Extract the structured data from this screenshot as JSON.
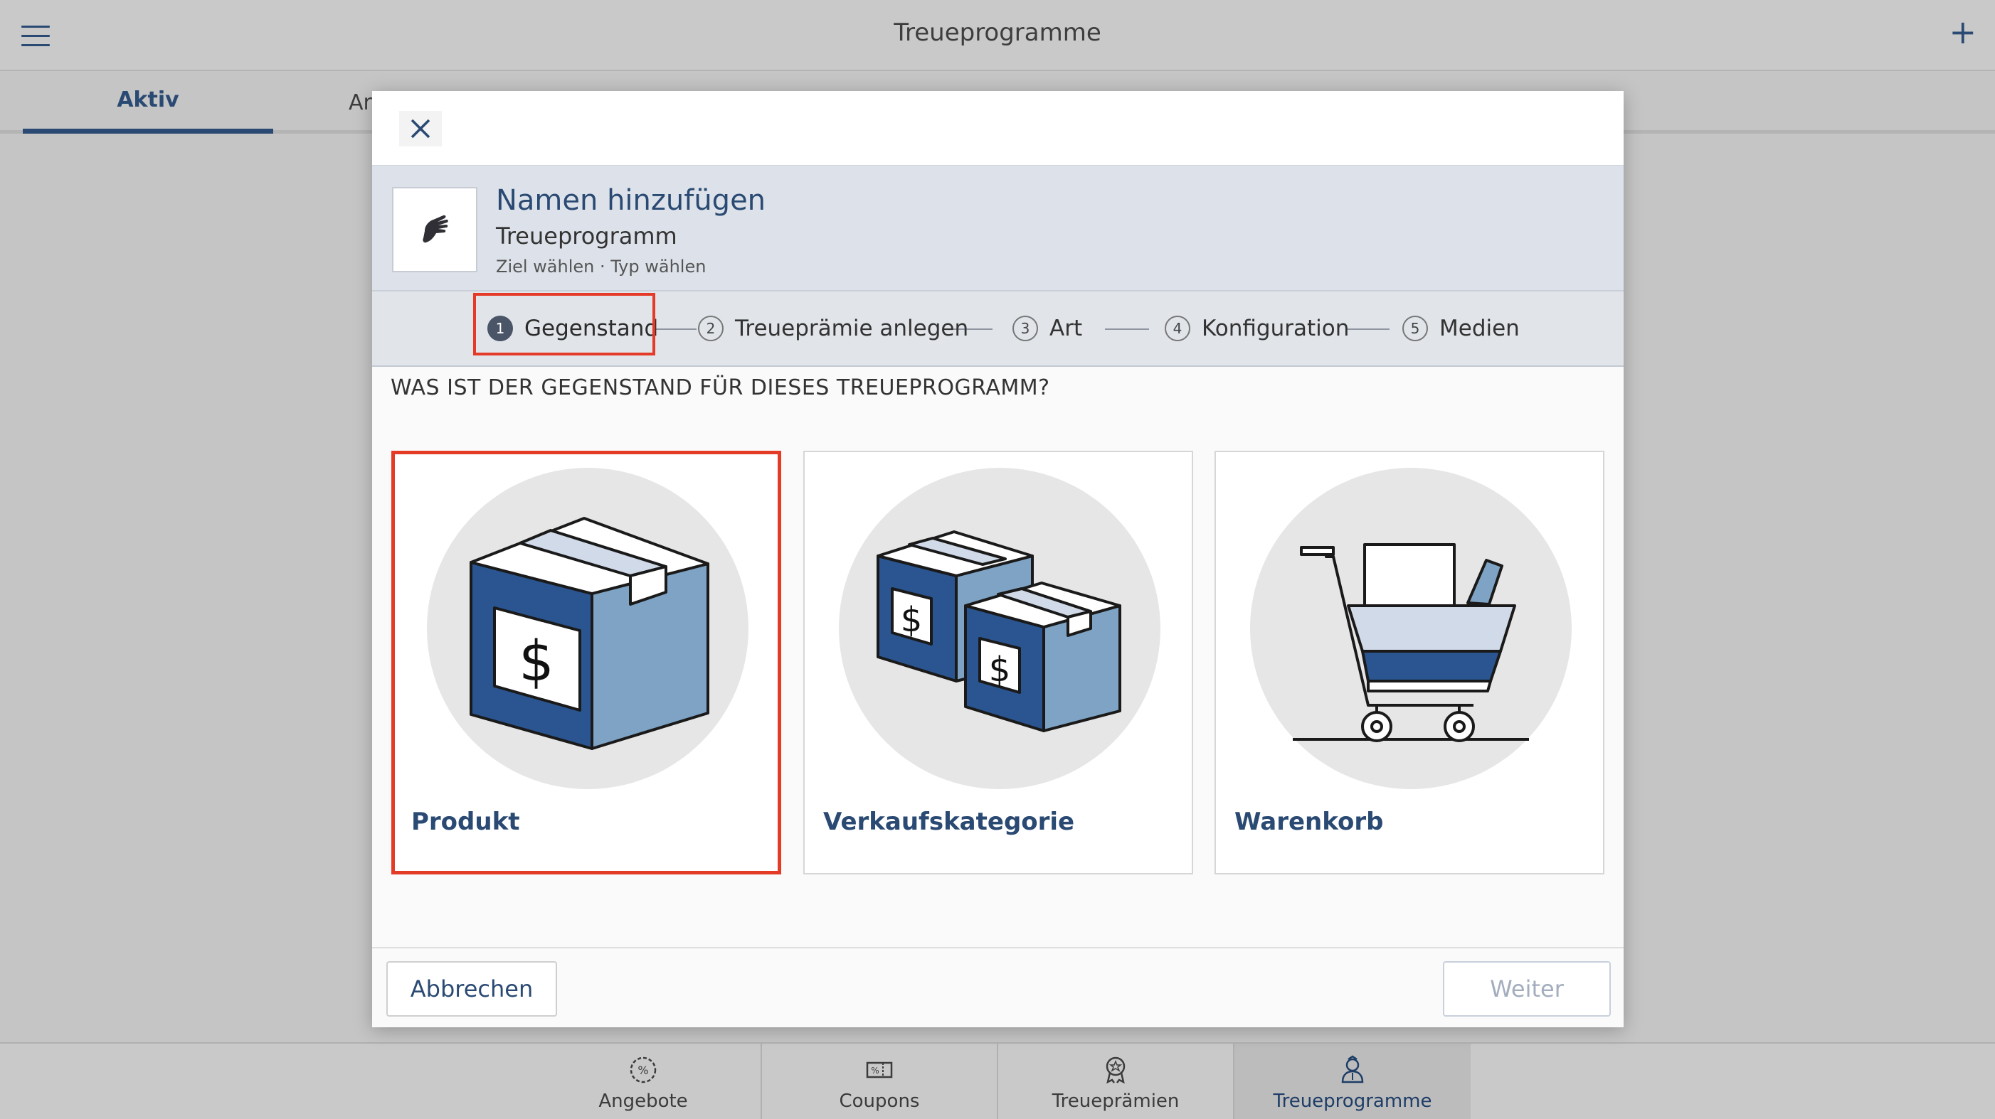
{
  "app": {
    "title": "Treueprogramme"
  },
  "tabs": [
    {
      "label": "Aktiv"
    },
    {
      "label": "Archiv"
    }
  ],
  "dialog": {
    "header": {
      "title": "Namen hinzufügen",
      "subtitle": "Treueprogramm",
      "breadcrumb": "Ziel wählen · Typ wählen",
      "icon": "hand-icon"
    },
    "steps": [
      {
        "num": "1",
        "label": "Gegenstand",
        "active": true
      },
      {
        "num": "2",
        "label": "Treueprämie anlegen"
      },
      {
        "num": "3",
        "label": "Art"
      },
      {
        "num": "4",
        "label": "Konfiguration"
      },
      {
        "num": "5",
        "label": "Medien"
      }
    ],
    "question": "WAS IST DER GEGENSTAND FÜR DIESES TREUEPROGRAMM?",
    "options": [
      {
        "label": "Produkt",
        "icon": "product-box-icon",
        "selected": true
      },
      {
        "label": "Verkaufskategorie",
        "icon": "category-boxes-icon"
      },
      {
        "label": "Warenkorb",
        "icon": "shopping-cart-icon"
      }
    ],
    "footer": {
      "cancel": "Abbrechen",
      "next": "Weiter"
    }
  },
  "bottom_nav": [
    {
      "label": "Angebote",
      "icon": "percent-badge-icon"
    },
    {
      "label": "Coupons",
      "icon": "coupon-icon"
    },
    {
      "label": "Treueprämien",
      "icon": "award-ribbon-icon"
    },
    {
      "label": "Treueprogramme",
      "icon": "loyalty-person-icon",
      "active": true
    }
  ],
  "colors": {
    "accent": "#2a4a73",
    "highlight": "#e43b27",
    "box_dark": "#2a5590",
    "box_light": "#7ea3c4"
  }
}
